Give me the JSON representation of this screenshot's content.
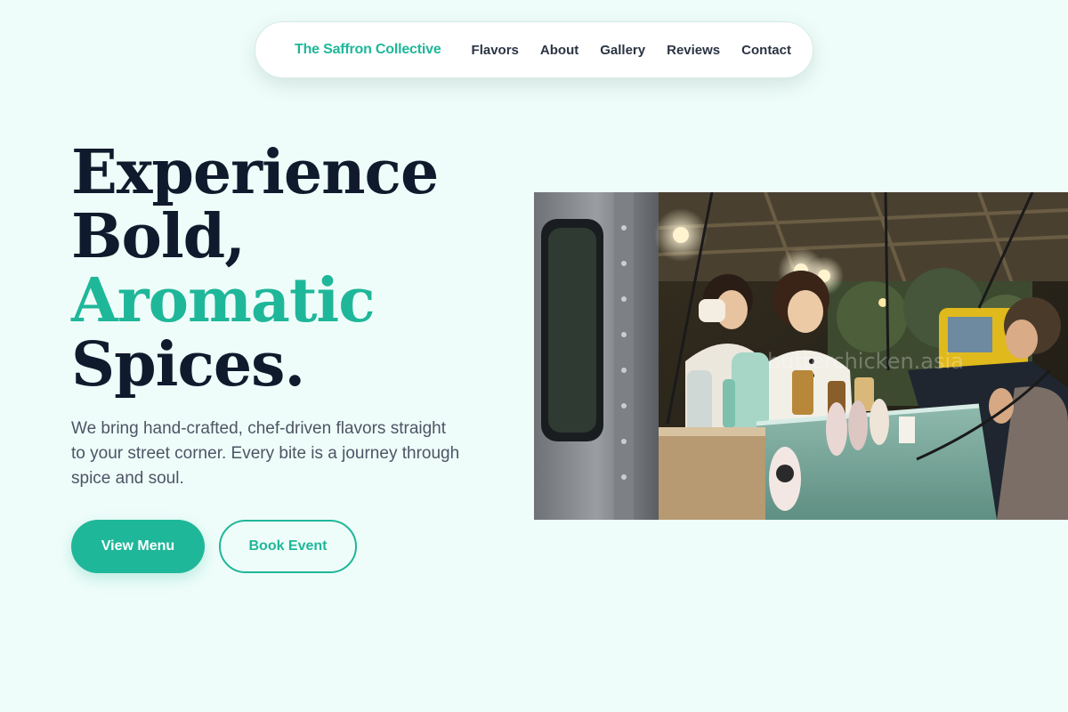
{
  "nav": {
    "brand": "The Saffron Collective",
    "links": [
      {
        "label": "Flavors"
      },
      {
        "label": "About"
      },
      {
        "label": "Gallery"
      },
      {
        "label": "Reviews"
      },
      {
        "label": "Contact"
      }
    ]
  },
  "hero": {
    "title_line1": "Experience",
    "title_line2": "Bold,",
    "title_accent": "Aromatic",
    "title_line4": "Spices.",
    "description": "We bring hand-crafted, chef-driven flavors straight to your street corner. Every bite is a journey through spice and soul.",
    "primary_button": "View Menu",
    "secondary_button": "Book Event"
  },
  "image": {
    "watermark": "butterchicken.asia"
  },
  "colors": {
    "accent": "#1fb799",
    "background": "#effdfa",
    "heading": "#0f1b2d",
    "body_text": "#4b5565"
  }
}
